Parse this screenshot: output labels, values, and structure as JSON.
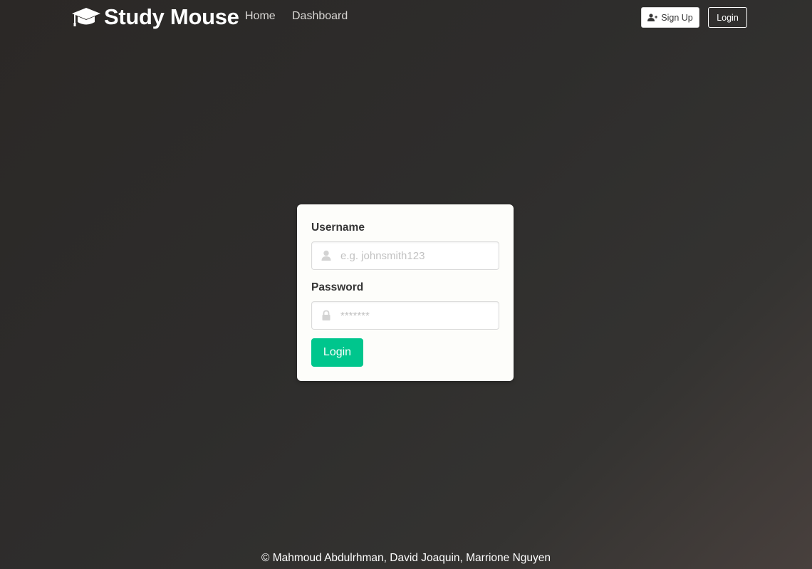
{
  "navbar": {
    "brand": {
      "icon": "graduation-cap-icon",
      "title": "Study Mouse"
    },
    "links": {
      "home": "Home",
      "dashboard": "Dashboard"
    },
    "signup": {
      "icon": "user-plus-icon",
      "label": "Sign Up"
    },
    "login_label": "Login"
  },
  "login_form": {
    "username": {
      "label": "Username",
      "icon": "user-icon",
      "value": "",
      "placeholder": "e.g. johnsmith123"
    },
    "password": {
      "label": "Password",
      "icon": "lock-icon",
      "value": "",
      "placeholder": "*******"
    },
    "submit_label": "Login"
  },
  "footer": {
    "copyright": "© Mahmoud Abdulrhman, David Joaquin, Marrione Nguyen"
  },
  "colors": {
    "accent": "#00c68d",
    "background": "#2e2d2c",
    "card": "#fdfdfa"
  }
}
